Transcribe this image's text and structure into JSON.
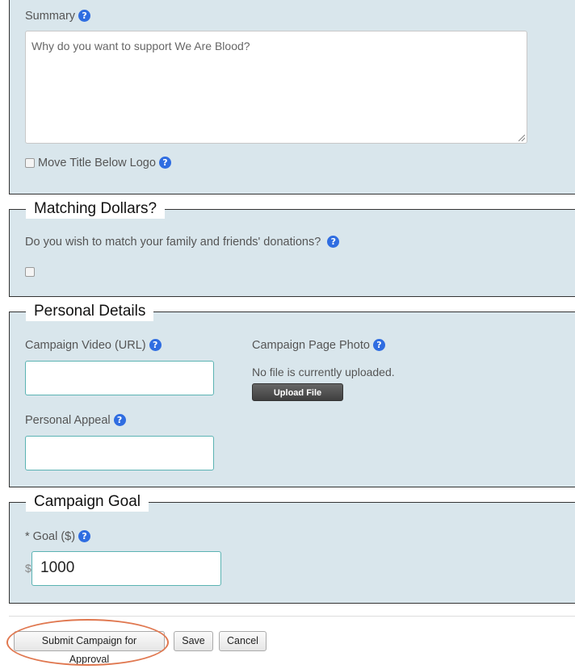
{
  "summary": {
    "label": "Summary",
    "placeholder": "Why do you want to support We Are Blood?",
    "move_title_label": "Move Title Below Logo"
  },
  "matching": {
    "legend": "Matching Dollars?",
    "question": "Do you wish to match your family and friends' donations?"
  },
  "personal": {
    "legend": "Personal Details",
    "video_label": "Campaign Video (URL)",
    "photo_label": "Campaign Page Photo",
    "no_file_text": "No file is currently uploaded.",
    "upload_button": "Upload File",
    "appeal_label": "Personal Appeal"
  },
  "goal": {
    "legend": "Campaign Goal",
    "label": "* Goal ($)",
    "currency": "$",
    "value": "1000"
  },
  "actions": {
    "submit": "Submit Campaign for Approval",
    "save": "Save",
    "cancel": "Cancel"
  },
  "help_glyph": "?",
  "colors": {
    "panel_bg": "#d9e6ec",
    "help_icon": "#2f6de1",
    "input_border": "#5bb3b3",
    "highlight": "#e07850"
  }
}
